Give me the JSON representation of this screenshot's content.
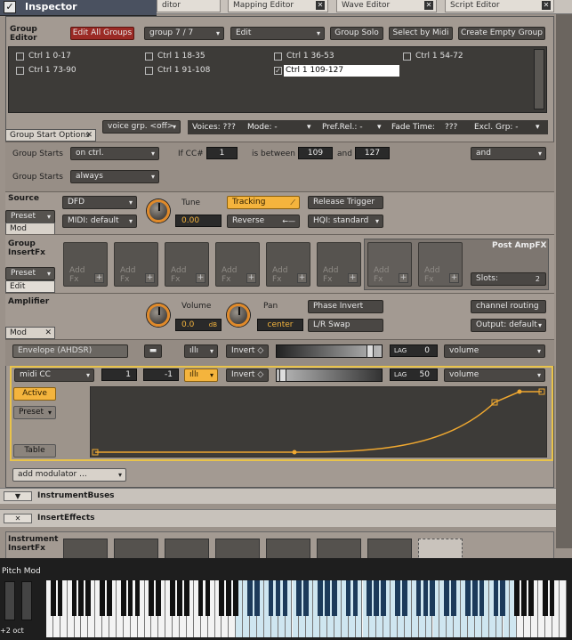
{
  "top_tabs": [
    "ditor",
    "Mapping Editor",
    "Wave Editor",
    "Script Editor"
  ],
  "inspector": {
    "title": "Inspector"
  },
  "group_editor": {
    "label_line1": "Group",
    "label_line2": "Editor",
    "edit_all_groups": "Edit All Groups",
    "group_select": "group 7 / 7",
    "edit_menu": "Edit",
    "group_solo": "Group Solo",
    "select_by_midi": "Select by Midi",
    "create_empty_group": "Create Empty Group",
    "groups": [
      {
        "name": "Ctrl 1 0-17",
        "checked": false
      },
      {
        "name": "Ctrl 1 18-35",
        "checked": false
      },
      {
        "name": "Ctrl 1 36-53",
        "checked": false
      },
      {
        "name": "Ctrl 1 54-72",
        "checked": false
      },
      {
        "name": "Ctrl 1 73-90",
        "checked": false
      },
      {
        "name": "Ctrl 1 91-108",
        "checked": false
      },
      {
        "name": "Ctrl 1 109-127",
        "checked": true
      }
    ]
  },
  "group_bar": {
    "voice_grp": "voice grp. <off>",
    "voices": "Voices: ???",
    "mode": "Mode: -",
    "pref_rel": "Pref.Rel.: -",
    "fade_time_label": "Fade Time:",
    "fade_time_value": "???",
    "excl_grp": "Excl. Grp: -"
  },
  "group_start": {
    "tab": "Group Start Options",
    "row1_label": "Group Starts",
    "row1_mode": "on ctrl.",
    "if_cc_label": "If CC#",
    "cc_number": "1",
    "is_between_label": "is between",
    "low": "109",
    "and_label": "and",
    "high": "127",
    "logic": "and",
    "row2_label": "Group Starts",
    "row2_mode": "always"
  },
  "source": {
    "title": "Source",
    "preset": "Preset",
    "mod": "Mod",
    "engine": "DFD",
    "midi": "MIDI: default",
    "tune_label": "Tune",
    "tune_value": "0.00",
    "tracking": "Tracking",
    "reverse": "Reverse",
    "release_trigger": "Release Trigger",
    "hqi": "HQI: standard"
  },
  "insert_fx": {
    "title_line1": "Group",
    "title_line2": "InsertFx",
    "preset": "Preset",
    "edit": "Edit",
    "slot_text_line1": "Add",
    "slot_text_line2": "Fx",
    "post_amp": "Post AmpFX",
    "slots_label": "Slots:",
    "slots_value": "2"
  },
  "amplifier": {
    "title": "Amplifier",
    "mod": "Mod",
    "volume_label": "Volume",
    "volume_value": "0.0",
    "volume_unit": "dB",
    "pan_label": "Pan",
    "pan_value": "center",
    "phase_invert": "Phase Invert",
    "lr_swap": "L/R Swap",
    "channel_routing": "channel routing",
    "output": "Output: default"
  },
  "envelope_row": {
    "name": "Envelope (AHDSR)",
    "invert": "Invert",
    "lag_label": "LAG",
    "lag_value": "0",
    "target": "volume",
    "slider_level": 0.92
  },
  "midi_cc_mod": {
    "source": "midi CC",
    "cc": "1",
    "amount": "-1",
    "invert": "Invert",
    "lag_label": "LAG",
    "lag_value": "50",
    "target": "volume",
    "active": "Active",
    "preset": "Preset",
    "table": "Table",
    "slider_level": 0.03
  },
  "add_modulator": "add modulator ...",
  "instrument_buses": "InstrumentBuses",
  "insert_effects": "InsertEffects",
  "instrument_insertfx_line1": "Instrument",
  "instrument_insertfx_line2": "InsertFx",
  "keyboard": {
    "pitch_mod": "Pitch Mod",
    "octave": "+2 oct"
  },
  "colors": {
    "accent": "#f4b43d",
    "active_red": "#9b2a25",
    "curve": "#f0a830"
  }
}
